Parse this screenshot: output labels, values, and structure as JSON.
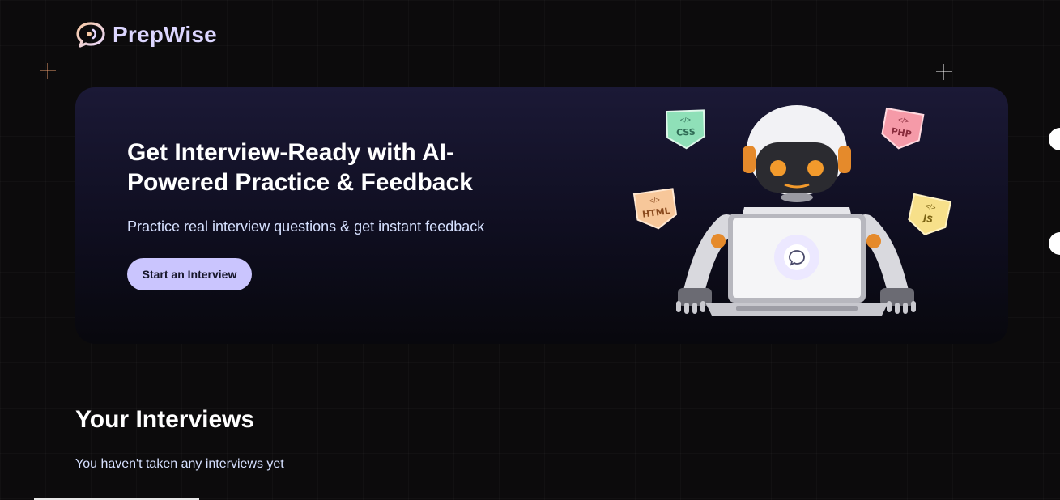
{
  "brand": {
    "name": "PrepWise",
    "icon": "chat-bubble-icon",
    "accent": "#cac5fe",
    "logo_color": "#f5c5a3"
  },
  "hero": {
    "title": "Get Interview-Ready with AI-Powered Practice & Feedback",
    "subtitle": "Practice real interview questions & get instant feedback",
    "cta_label": "Start an Interview",
    "illustration": "robot-with-laptop",
    "badges": [
      {
        "label": "CSS",
        "icon": "code-icon",
        "color": "#8fe0b8"
      },
      {
        "label": "PHP",
        "icon": "code-icon",
        "color": "#f59aa8"
      },
      {
        "label": "HTML",
        "icon": "code-icon",
        "color": "#f7c79a"
      },
      {
        "label": "JS",
        "icon": "code-icon",
        "color": "#f7e08a"
      }
    ]
  },
  "interviews": {
    "title": "Your Interviews",
    "empty_message": "You haven't taken any interviews yet"
  }
}
